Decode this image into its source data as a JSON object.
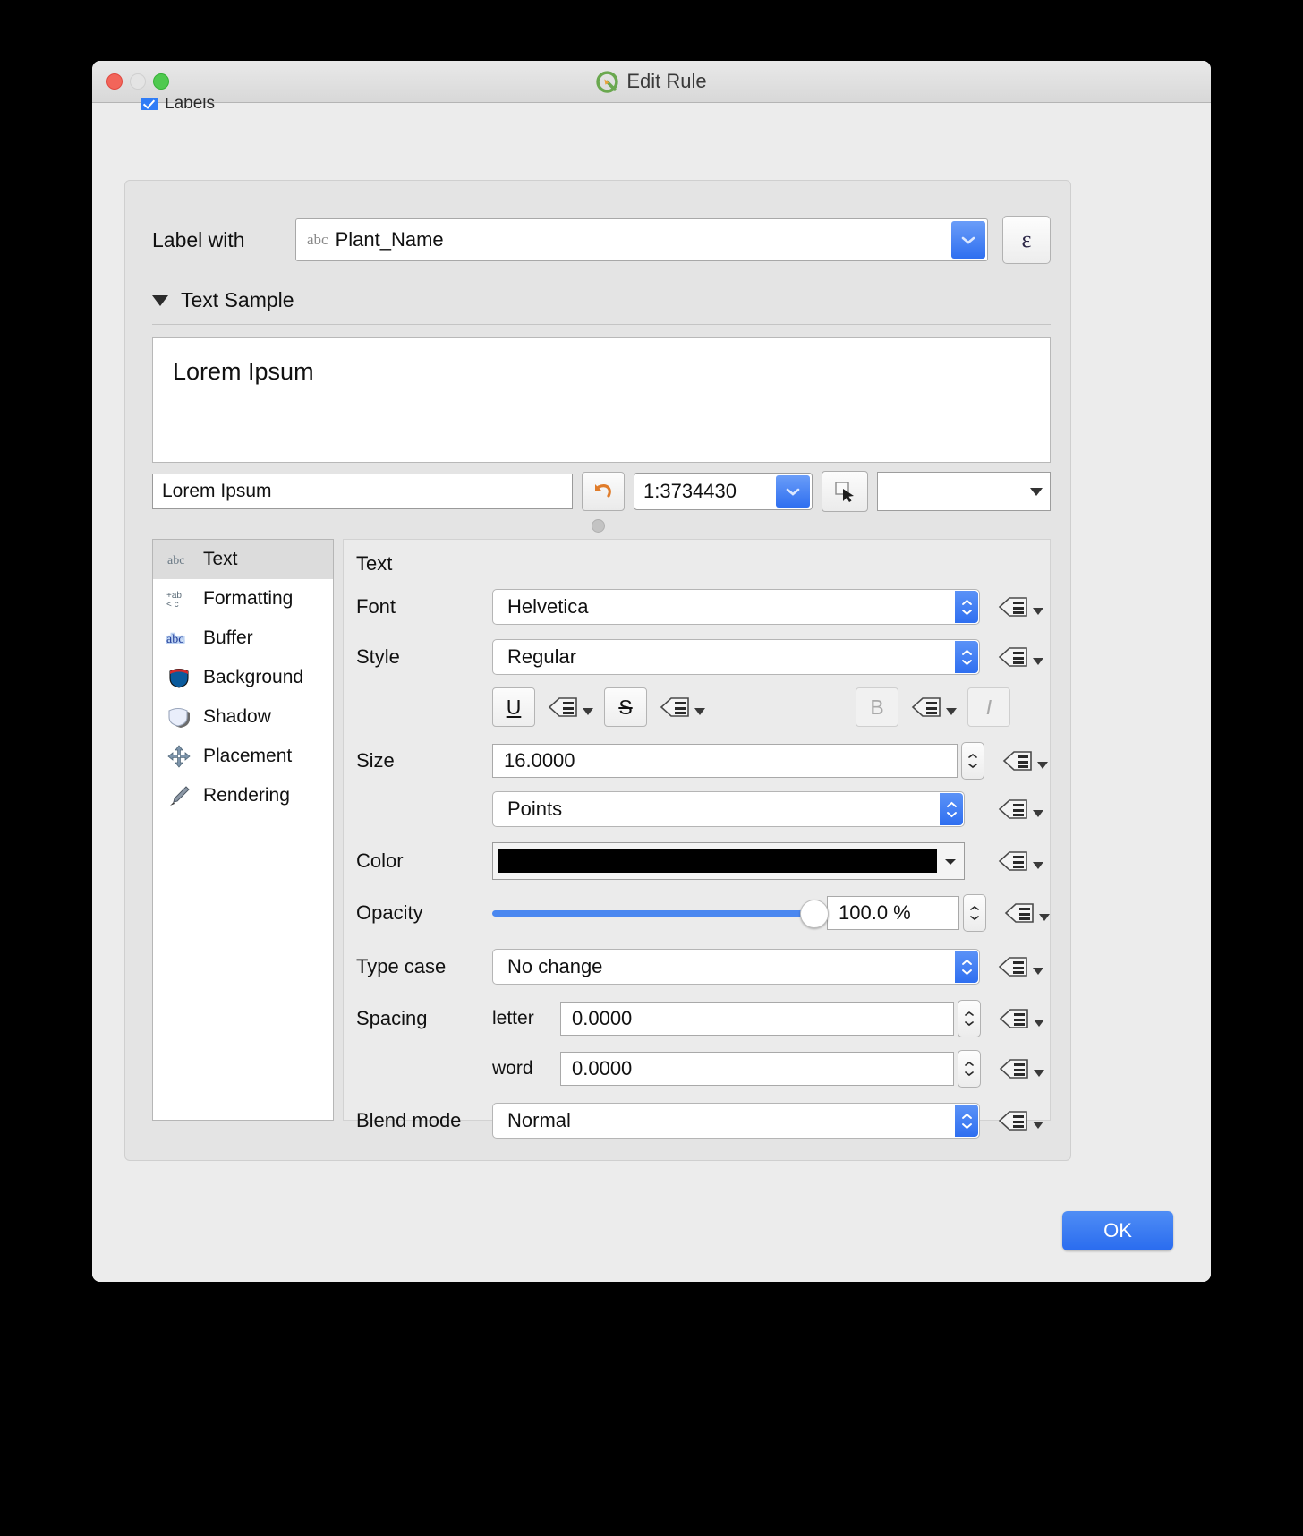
{
  "window": {
    "title": "Edit Rule",
    "logo_icon": "qgis-logo-icon",
    "close_icon": "close-icon",
    "minimize_icon": "minimize-icon",
    "zoom_icon": "zoom-icon"
  },
  "labels_checkbox": {
    "label": "Labels",
    "checked": true
  },
  "label_with": {
    "label": "Label with",
    "field_badge": "abc",
    "value": "Plant_Name",
    "dropdown_icon": "chevron-down-icon",
    "expression_button": "ε"
  },
  "text_sample": {
    "section_title": "Text Sample",
    "collapse_icon": "triangle-down-icon",
    "preview_text": "Lorem Ipsum",
    "input_value": "Lorem Ipsum",
    "revert_icon": "revert-arrow-icon",
    "scale_value": "1:3734430",
    "scale_dropdown_icon": "chevron-down-icon",
    "pick_cursor_icon": "cursor-pick-icon",
    "background_color_value": "",
    "background_dropdown_icon": "triangle-down-icon"
  },
  "sidebar": {
    "items": [
      {
        "label": "Text",
        "icon": "text-abc-icon",
        "selected": true
      },
      {
        "label": "Formatting",
        "icon": "formatting-icon",
        "selected": false
      },
      {
        "label": "Buffer",
        "icon": "buffer-abc-icon",
        "selected": false
      },
      {
        "label": "Background",
        "icon": "background-shield-icon",
        "selected": false
      },
      {
        "label": "Shadow",
        "icon": "shadow-shield-icon",
        "selected": false
      },
      {
        "label": "Placement",
        "icon": "placement-arrows-icon",
        "selected": false
      },
      {
        "label": "Rendering",
        "icon": "rendering-brush-icon",
        "selected": false
      }
    ]
  },
  "text_panel": {
    "title": "Text",
    "font": {
      "label": "Font",
      "value": "Helvetica"
    },
    "style": {
      "label": "Style",
      "value": "Regular"
    },
    "format_buttons": {
      "underline": "U",
      "strikethrough": "S",
      "bold": "B",
      "italic": "I"
    },
    "size": {
      "label": "Size",
      "value": "16.0000"
    },
    "units": {
      "value": "Points"
    },
    "color": {
      "label": "Color",
      "value": "#000000"
    },
    "opacity": {
      "label": "Opacity",
      "value": "100.0 %",
      "percent": 100
    },
    "type_case": {
      "label": "Type case",
      "value": "No change"
    },
    "spacing": {
      "label": "Spacing",
      "letter_label": "letter",
      "letter_value": "0.0000",
      "word_label": "word",
      "word_value": "0.0000"
    },
    "blend_mode": {
      "label": "Blend mode",
      "value": "Normal"
    },
    "override_icon": "data-defined-override-icon"
  },
  "footer": {
    "ok_label": "OK"
  },
  "colors": {
    "accent_blue": "#2f6ff0",
    "window_bg": "#ececec",
    "panel_bg": "#e4e4e4",
    "text_color": "#000000"
  }
}
